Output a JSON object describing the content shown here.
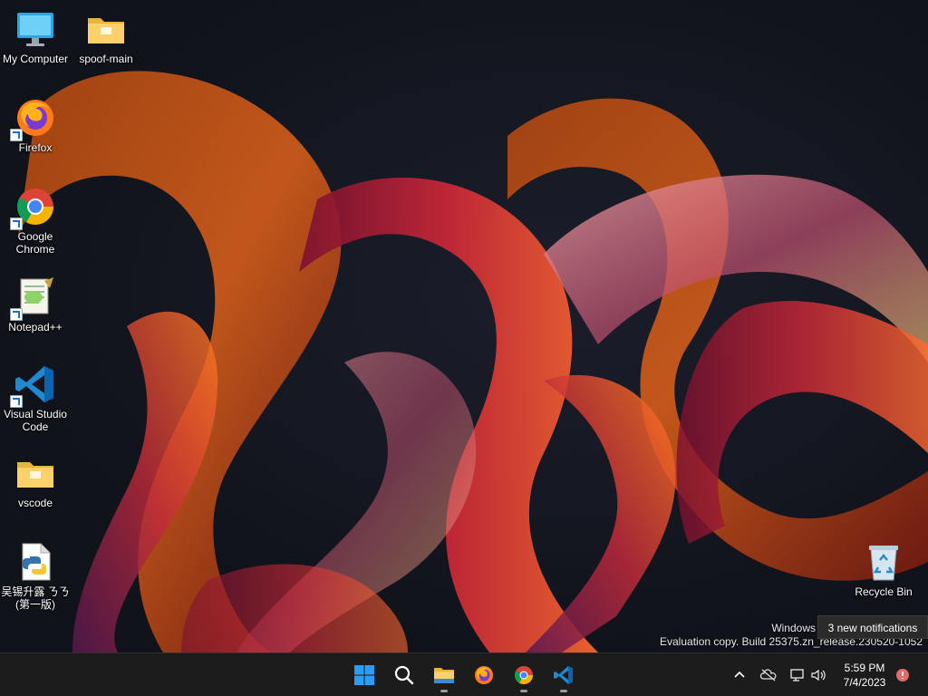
{
  "desktop_icons": [
    {
      "label": "My Computer",
      "icon": "computer-icon"
    },
    {
      "label": "spoof-main",
      "icon": "folder-icon"
    },
    {
      "label": "Firefox",
      "icon": "firefox-icon"
    },
    {
      "label": "Google Chrome",
      "icon": "chrome-icon"
    },
    {
      "label": "Notepad++",
      "icon": "notepadpp-icon"
    },
    {
      "label": "Visual Studio Code",
      "icon": "vscode-icon"
    },
    {
      "label": "vscode",
      "icon": "folder-icon"
    },
    {
      "label": "吴锡升露 ㄋㄋ(第一版)",
      "icon": "python-file-icon"
    },
    {
      "label": "Recycle Bin",
      "icon": "recycle-bin-icon"
    }
  ],
  "watermark": {
    "line1": "Windows",
    "line2": "Evaluation copy. Build 25375.zn_release.230520-1052"
  },
  "notification_tip": "3 new notifications",
  "taskbar": {
    "apps": [
      "start-icon",
      "search-icon",
      "file-explorer-icon",
      "firefox-icon",
      "chrome-icon",
      "vscode-icon"
    ],
    "tray_icons": [
      "chevron-up-icon",
      "onedrive-offline-icon",
      "network-icon",
      "volume-icon"
    ],
    "clock": {
      "time": "5:59 PM",
      "date": "7/4/2023"
    },
    "notification_badge_color": "#e06c6c"
  },
  "colors": {
    "taskbar": "#1c1c1c",
    "desktop": "#13151f",
    "accent": "#0078d4"
  }
}
